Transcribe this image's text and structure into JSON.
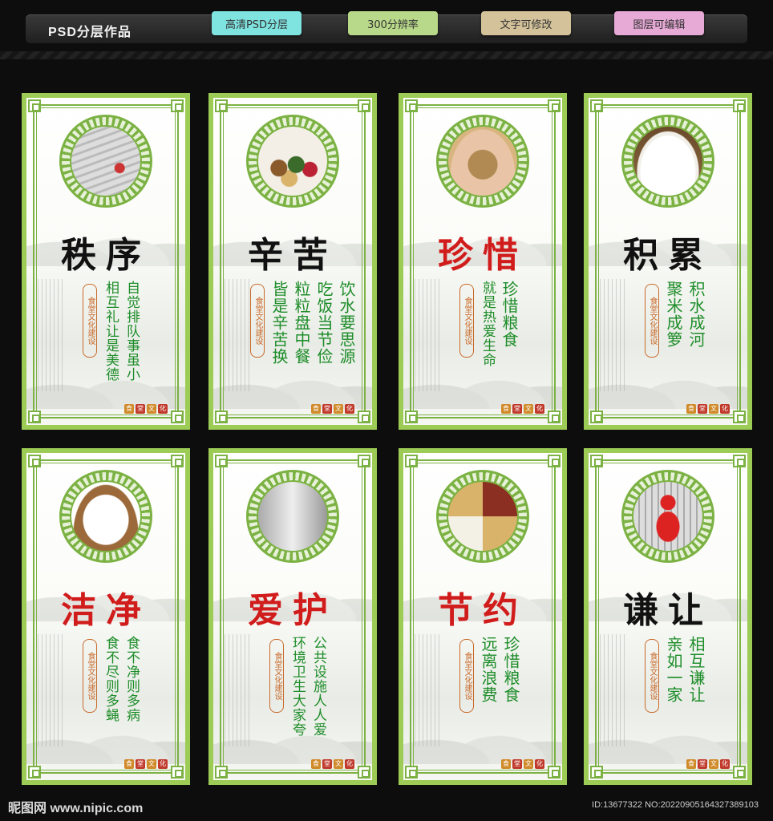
{
  "header": {
    "title": "PSD分层作品",
    "tags": [
      {
        "label": "高清PSD分层",
        "color": "#7fe3e0"
      },
      {
        "label": "300分辨率",
        "color": "#b9d98a"
      },
      {
        "label": "文字可修改",
        "color": "#d4c39a"
      },
      {
        "label": "图层可编辑",
        "color": "#e7a9d6"
      }
    ]
  },
  "panels": [
    {
      "headline": "秩序",
      "headline_color": "#111111",
      "seal": "食堂文化建设",
      "lines": [
        "自觉排队事虽小",
        "相互礼让是美德"
      ],
      "image": "queue-figures-icon"
    },
    {
      "headline": "辛苦",
      "headline_color": "#111111",
      "seal": "食堂文化建设",
      "lines": [
        "饮水要思源",
        "吃饭当节俭",
        "粒粒盘中餐",
        "皆是辛苦换"
      ],
      "image": "grain-bowls-icon"
    },
    {
      "headline": "珍惜",
      "headline_color": "#d11c1c",
      "seal": "食堂文化建设",
      "lines": [
        "珍惜粮食",
        "就是热爱生命"
      ],
      "image": "hands-grain-icon"
    },
    {
      "headline": "积累",
      "headline_color": "#111111",
      "seal": "食堂文化建设",
      "lines": [
        "积水成河",
        "聚米成箩"
      ],
      "image": "rice-basket-icon"
    },
    {
      "headline": "洁净",
      "headline_color": "#d11c1c",
      "seal": "食堂文化建设",
      "lines": [
        "食不净则多病",
        "食不尽则多蝇"
      ],
      "image": "rice-bowl-icon"
    },
    {
      "headline": "爱护",
      "headline_color": "#d11c1c",
      "seal": "食堂文化建设",
      "lines": [
        "公共设施人人爱",
        "环境卫生大家夸"
      ],
      "image": "steel-pots-icon"
    },
    {
      "headline": "节约",
      "headline_color": "#d11c1c",
      "seal": "食堂文化建设",
      "lines": [
        "珍惜粮食",
        "远离浪费"
      ],
      "image": "spoons-grain-icon"
    },
    {
      "headline": "谦让",
      "headline_color": "#111111",
      "seal": "食堂文化建设",
      "lines": [
        "相互谦让",
        "亲如一家"
      ],
      "image": "red-leader-icon"
    }
  ],
  "stamp": [
    "食",
    "堂",
    "文",
    "化"
  ],
  "watermark": "昵图网 www.nipic.com",
  "image_id": "ID:13677322 NO:20220905164327389103"
}
